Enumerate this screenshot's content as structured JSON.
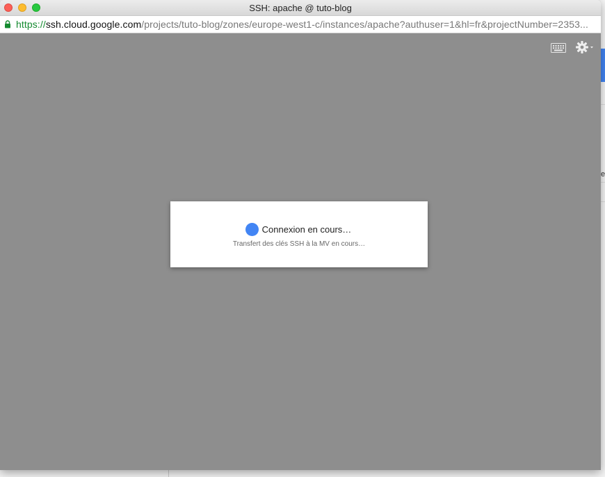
{
  "window": {
    "title": "SSH: apache @ tuto-blog"
  },
  "address_bar": {
    "scheme": "https://",
    "host": "ssh.cloud.google.com",
    "path": "/projects/tuto-blog/zones/europe-west1-c/instances/apache?authuser=1&hl=fr&projectNumber=2353..."
  },
  "toolbar": {
    "keyboard_icon": "keyboard-icon",
    "settings_icon": "gear-icon"
  },
  "dialog": {
    "title": "Connexion en cours…",
    "subtitle": "Transfert des clés SSH à la MV en cours…",
    "spinner_color": "#4285f4"
  },
  "background_page": {
    "partial_text": "e"
  },
  "colors": {
    "overlay": "#8e8e8e",
    "secure_green": "#148a2f",
    "accent_blue": "#4285f4"
  }
}
